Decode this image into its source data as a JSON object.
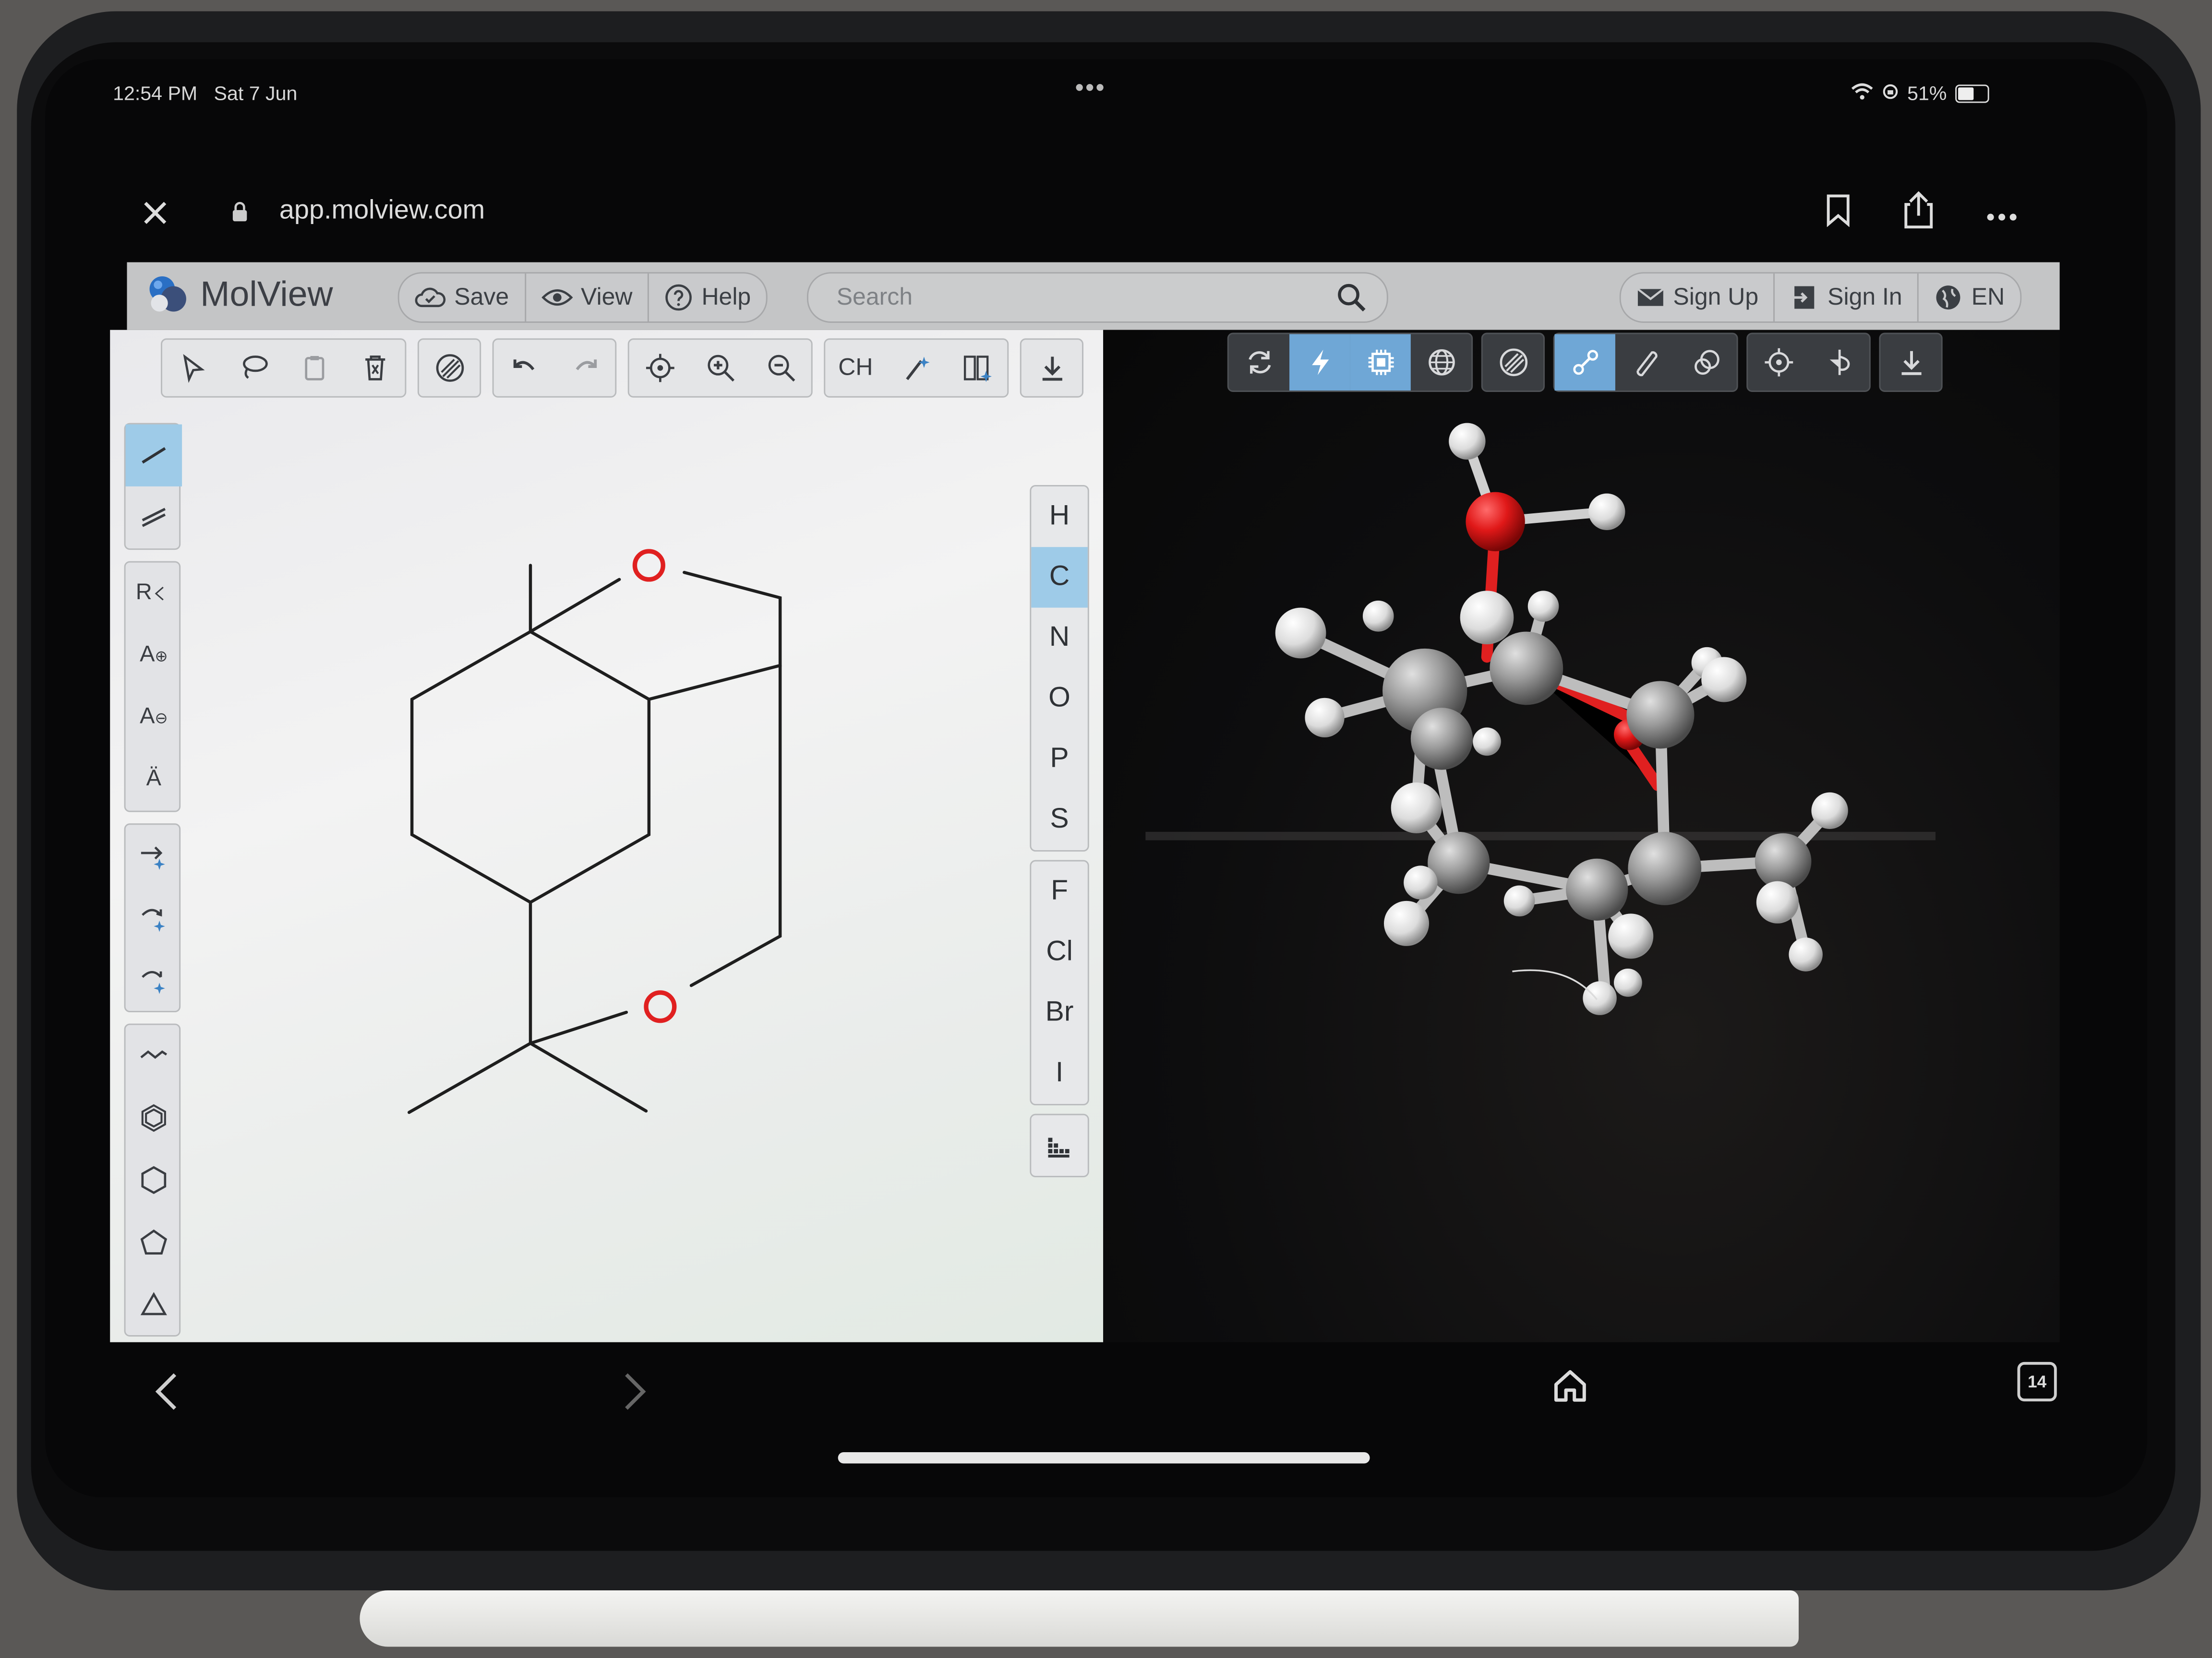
{
  "status": {
    "time": "12:54 PM",
    "date": "Sat 7 Jun",
    "battery": "51%",
    "battery_level": 0.51
  },
  "browser": {
    "url": "app.molview.com",
    "close_icon": "close-icon",
    "lock_icon": "lock-icon"
  },
  "header": {
    "app_name": "MolView",
    "save_label": "Save",
    "view_label": "View",
    "help_label": "Help",
    "search_placeholder": "Search",
    "signup_label": "Sign Up",
    "signin_label": "Sign In",
    "language_label": "EN"
  },
  "toolbar": {
    "ch_label": "CH"
  },
  "left_tools": {
    "r_group_label": "R",
    "charge_plus_label": "A",
    "charge_minus_label": "A",
    "lone_pair_label": "Ä"
  },
  "elements": [
    "H",
    "C",
    "N",
    "O",
    "P",
    "S",
    "F",
    "Cl",
    "Br",
    "I"
  ],
  "selected_element": "C",
  "navbar": {
    "tabs_count": "14"
  },
  "colors": {
    "accent_blue": "#9ecbe8",
    "oxygen_red": "#e02020",
    "header_bg": "#c4c5c6",
    "viewer_bg": "#0d0d0e"
  }
}
